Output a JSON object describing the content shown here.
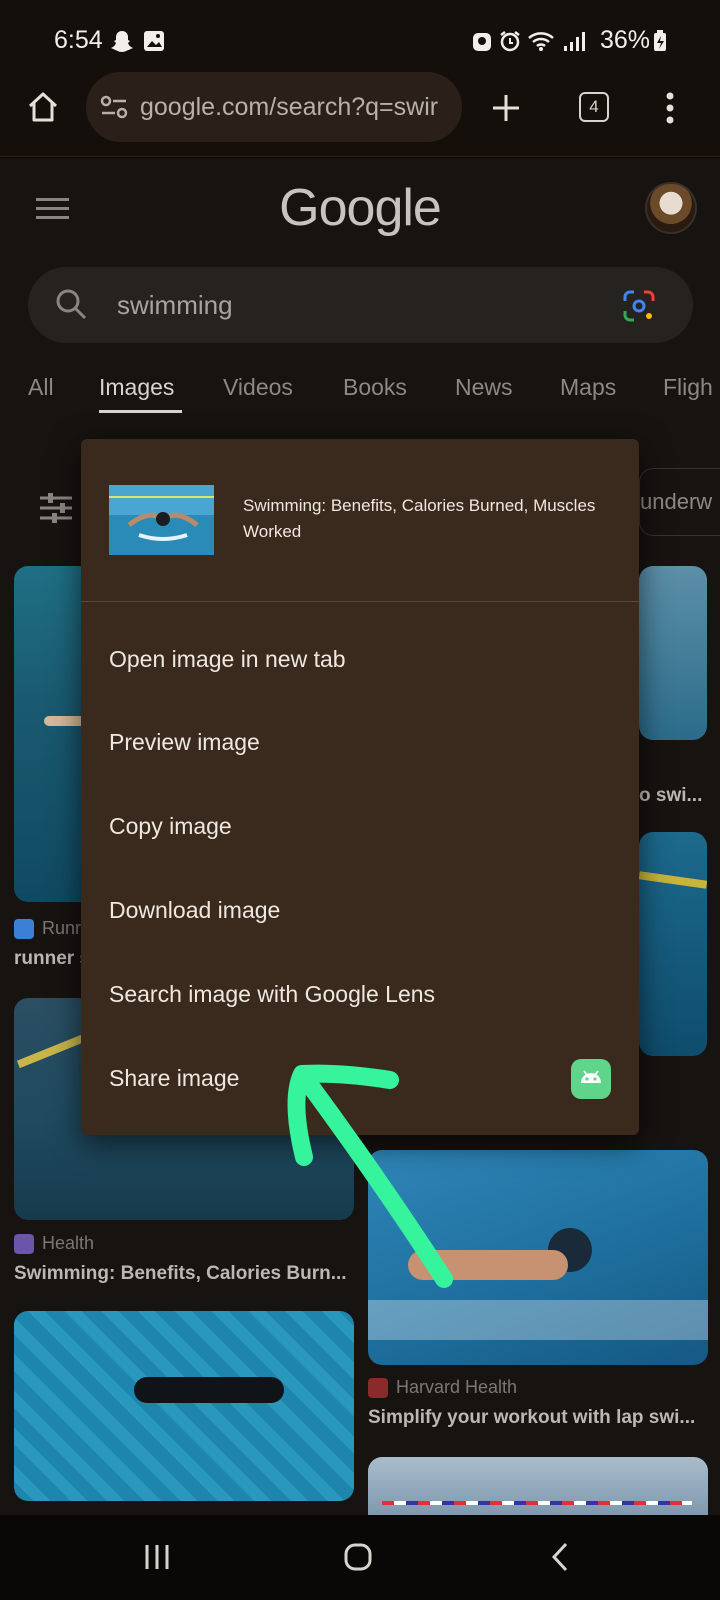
{
  "status_bar": {
    "time": "6:54",
    "battery": "36%"
  },
  "browser": {
    "url": "google.com/search?q=swir",
    "tab_count": "4"
  },
  "google": {
    "logo": "Google",
    "query": "swimming",
    "tabs": [
      "All",
      "Images",
      "Videos",
      "Books",
      "News",
      "Maps",
      "Fligh"
    ],
    "active_tab": "Images",
    "chip_partial": "underw"
  },
  "results": [
    {
      "source": "Runr",
      "title": "runner s"
    },
    {
      "source": "",
      "title": "o swi..."
    },
    {
      "source": "Health",
      "title": "Swimming: Benefits, Calories Burn..."
    },
    {
      "source": "Harvard Health",
      "title": "Simplify your workout with lap swi..."
    }
  ],
  "context_menu": {
    "image_title": "Swimming: Benefits, Calories Burned, Muscles Worked",
    "items": [
      "Open image in new tab",
      "Preview image",
      "Copy image",
      "Download image",
      "Search image with Google Lens",
      "Share image"
    ]
  },
  "colors": {
    "menu_bg": "#3a291d",
    "annotation_arrow": "#36f49c",
    "page_bg": "#161310"
  }
}
